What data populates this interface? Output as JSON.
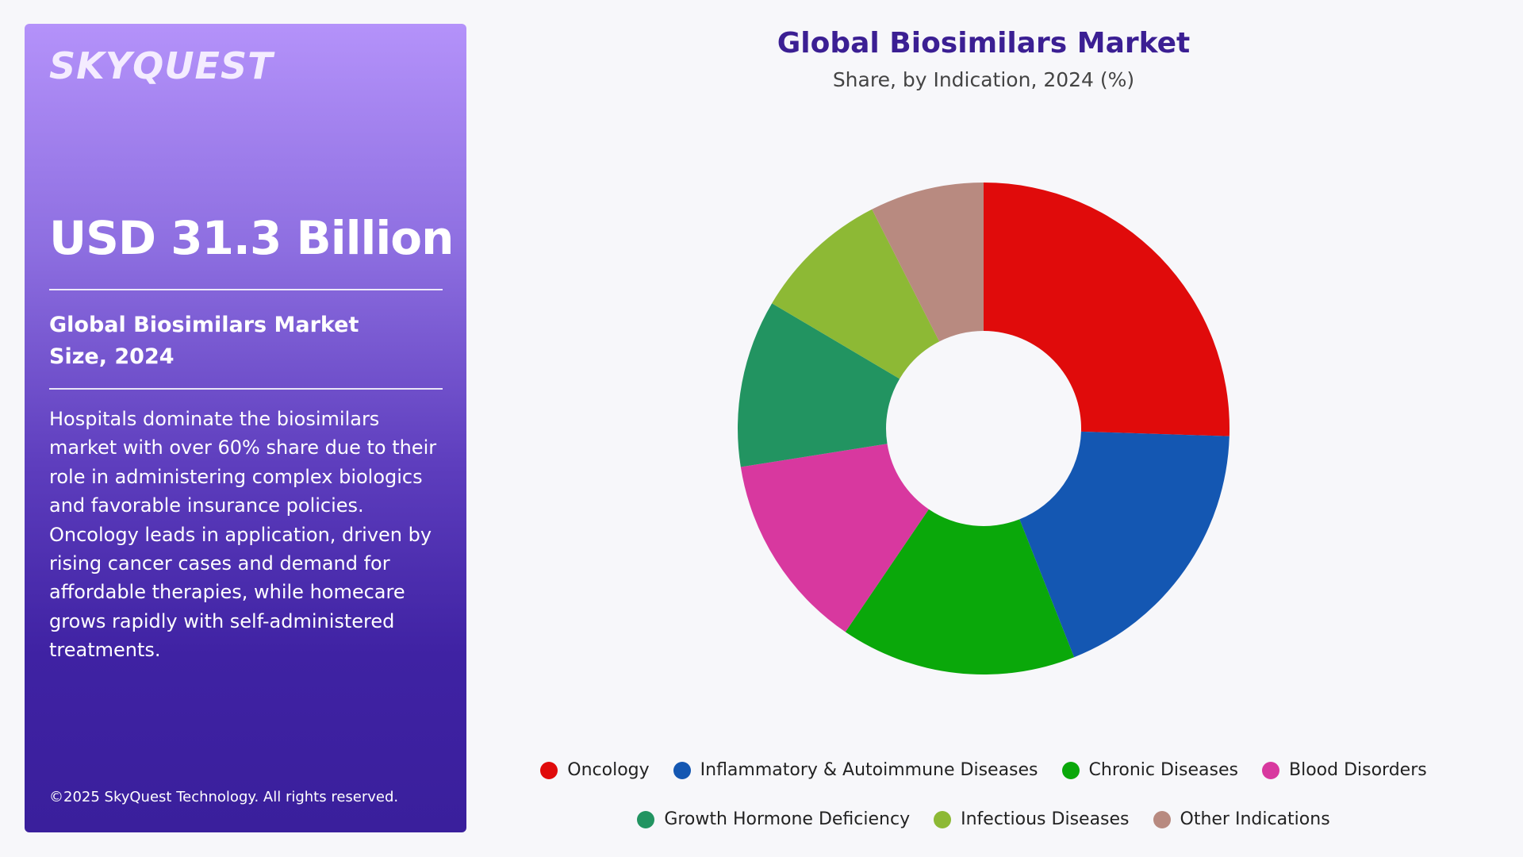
{
  "panel": {
    "logo": "SKYQUEST",
    "value": "USD 31.3 Billion",
    "metric_label": "Global Biosimilars Market Size, 2024",
    "description": "Hospitals dominate the biosimilars market with over 60% share due to their role in administering complex biologics and favorable insurance policies. Oncology leads in application, driven by rising cancer cases and demand for affordable therapies, while homecare grows rapidly with self-administered treatments.",
    "copyright": "©2025 SkyQuest Technology. All rights reserved."
  },
  "chart_data": {
    "type": "pie",
    "donut": true,
    "title": "Global Biosimilars Market",
    "subtitle": "Share, by Indication, 2024 (%)",
    "categories": [
      "Oncology",
      "Inflammatory & Autoimmune Diseases",
      "Chronic Diseases",
      "Blood Disorders",
      "Growth Hormone Deficiency",
      "Infectious Diseases",
      "Other Indications"
    ],
    "values": [
      25.5,
      18.5,
      15.5,
      13,
      11,
      9,
      7.5
    ],
    "colors": [
      "#e00b0b",
      "#1457b2",
      "#0aa80a",
      "#d8389f",
      "#229461",
      "#8db935",
      "#b88a80"
    ],
    "legend_position": "bottom"
  }
}
